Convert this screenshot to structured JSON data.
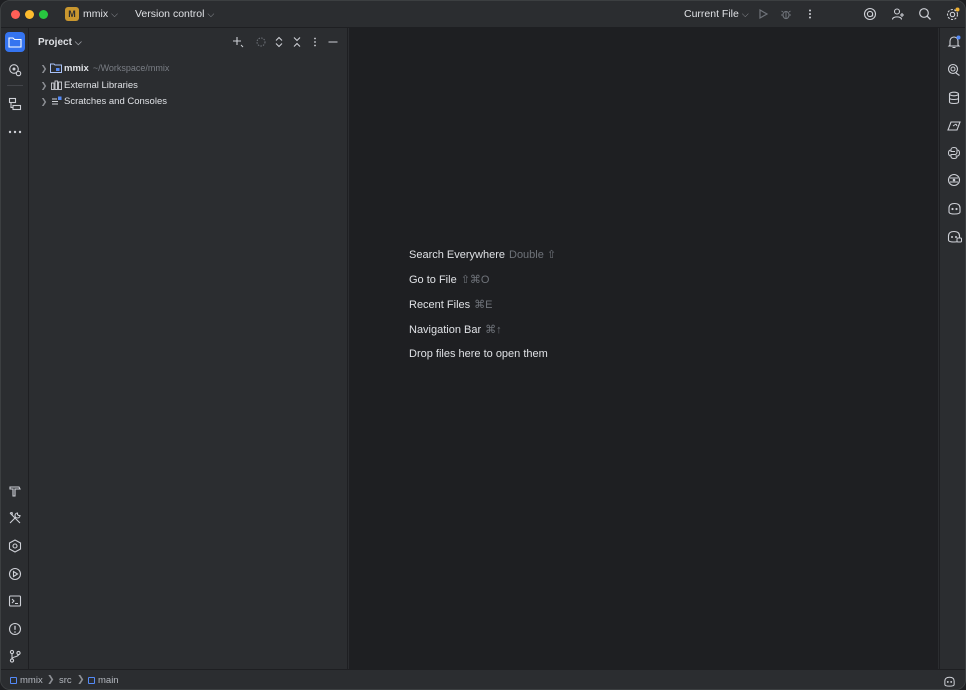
{
  "titlebar": {
    "project_badge": "M",
    "project_name": "mmix",
    "vcs_label": "Version control",
    "run_config": "Current File",
    "icons": [
      "run-icon",
      "debug-icon",
      "more-icon",
      "ai-assistant-icon",
      "add-user-icon",
      "search-icon",
      "settings-icon"
    ]
  },
  "left_toolbar": {
    "top": [
      "project-icon",
      "commit-icon",
      "structure-icon",
      "more-tools-icon"
    ],
    "bottom": [
      "build-icon",
      "services-icon",
      "plugins-icon",
      "run-panel-icon",
      "terminal-icon",
      "problems-icon",
      "git-icon"
    ]
  },
  "project_panel": {
    "title": "Project",
    "actions": [
      "add-icon",
      "locate-icon",
      "expand-all-icon",
      "collapse-all-icon",
      "options-icon",
      "hide-icon"
    ],
    "tree": [
      {
        "label": "mmix",
        "path": "~/Workspace/mmix",
        "icon": "module-folder-icon"
      },
      {
        "label": "External Libraries",
        "icon": "library-icon"
      },
      {
        "label": "Scratches and Consoles",
        "icon": "scratches-icon"
      }
    ]
  },
  "editor": {
    "hints": [
      {
        "label": "Search Everywhere",
        "shortcut": "Double ⇧"
      },
      {
        "label": "Go to File",
        "shortcut": "⇧⌘O"
      },
      {
        "label": "Recent Files",
        "shortcut": "⌘E"
      },
      {
        "label": "Navigation Bar",
        "shortcut": "⌘↑"
      },
      {
        "label": "Drop files here to open them",
        "shortcut": ""
      }
    ]
  },
  "right_toolbar": {
    "icons": [
      "notifications-icon",
      "ai-chat-icon",
      "database-icon",
      "endpoints-icon",
      "python-icon",
      "remote-icon",
      "copilot-icon",
      "copilot-chat-icon"
    ]
  },
  "statusbar": {
    "breadcrumbs": [
      "mmix",
      "src",
      "main"
    ],
    "right_icon": "copilot-status-icon"
  },
  "colors": {
    "accent": "#3574f0",
    "background": "#2b2d30",
    "editor_background": "#1e1f22",
    "project_badge": "#c9972f"
  }
}
